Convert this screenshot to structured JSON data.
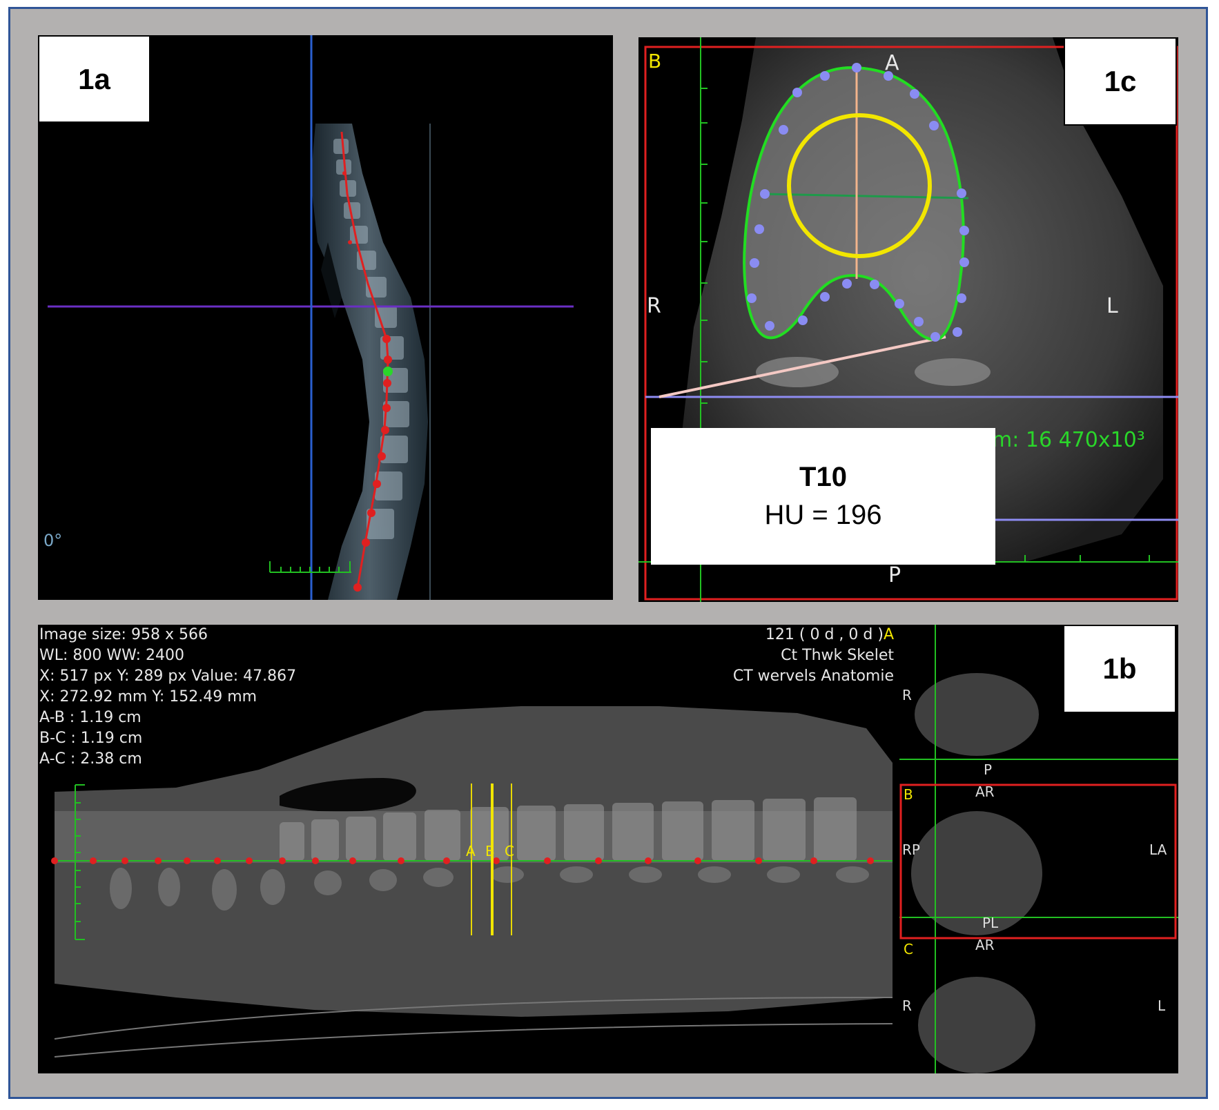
{
  "panels": {
    "p1a": {
      "badge": "1a",
      "angle": "0°"
    },
    "p1c": {
      "badge": "1c",
      "orientation": {
        "top": "A",
        "left": "R",
        "right": "L",
        "bottom": "P",
        "corner": "B"
      },
      "overlay_partial": "m: 16  470x10³",
      "vertebra": "T10",
      "hu": "HU = 196"
    },
    "p1b": {
      "badge": "1b",
      "info_left": [
        "Image size: 958 x 566",
        "WL: 800 WW: 2400",
        "X: 517 px Y: 289 px Value: 47.867",
        "X: 272.92 mm Y: 152.49 mm",
        "A-B : 1.19 cm",
        "B-C : 1.19 cm",
        "A-C : 2.38 cm"
      ],
      "info_right": [
        "121 ( 0 d , 0 d )",
        "Ct Thwk Skelet",
        "CT wervels Anatomie"
      ],
      "info_right_marker": "A",
      "slice_markers": [
        "A",
        "B",
        "C"
      ],
      "axial_views": [
        {
          "corner": "",
          "top": "",
          "left": "R",
          "right": "",
          "bottom": "P"
        },
        {
          "corner": "B",
          "top": "AR",
          "left": "RP",
          "right": "LA",
          "bottom": "PL"
        },
        {
          "corner": "C",
          "top": "AR",
          "left": "R",
          "right": "L",
          "bottom": ""
        }
      ]
    }
  },
  "colors": {
    "frame_border": "#2f5597",
    "frame_background": "#b3b1b0",
    "spline_red": "#e02020",
    "contour_green": "#22dd22",
    "roi_yellow": "#f2e600",
    "control_point_blue": "#8a8cf2"
  }
}
